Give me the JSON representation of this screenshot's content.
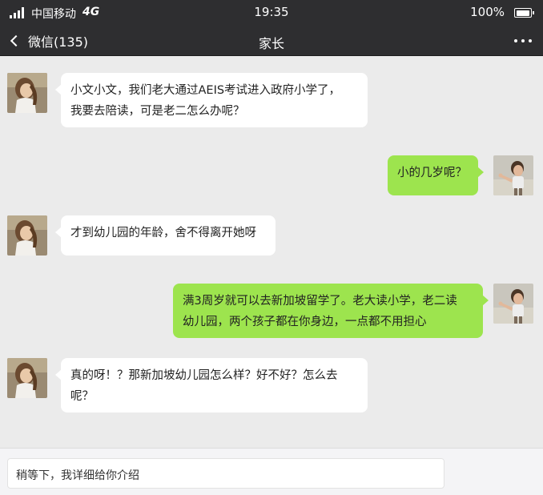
{
  "status_bar": {
    "carrier": "中国移动",
    "network": "4G",
    "time": "19:35",
    "battery_percent": "100%",
    "battery_level": 1.0
  },
  "nav": {
    "back_label": "微信(135)",
    "title": "家长",
    "back_icon": "chevron-left-icon",
    "more_icon": "more-dots-icon"
  },
  "messages": [
    {
      "side": "left",
      "sender": "parent",
      "lines": [
        "小文小文，我们老大通过AEIS考试进入政府小学了，",
        "我要去陪读，可是老二怎么办呢？"
      ]
    },
    {
      "side": "right",
      "sender": "me",
      "lines": [
        "小的几岁呢？"
      ]
    },
    {
      "side": "left",
      "sender": "parent",
      "lines": [
        "才到幼儿园的年龄，舍不得离开她呀"
      ]
    },
    {
      "side": "right",
      "sender": "me",
      "lines": [
        "满3周岁就可以去新加坡留学了。老大读小学，老二读",
        "幼儿园，两个孩子都在你身边，一点都不用担心"
      ]
    },
    {
      "side": "left",
      "sender": "parent",
      "lines": [
        "真的呀！？那新加坡幼儿园怎么样？好不好？怎么去",
        "呢？"
      ]
    }
  ],
  "input": {
    "value": "稍等下，我详细给你介绍"
  },
  "colors": {
    "bar_bg": "#2e2e30",
    "chat_bg": "#ebebeb",
    "bubble_left": "#ffffff",
    "bubble_right": "#9de44e"
  }
}
